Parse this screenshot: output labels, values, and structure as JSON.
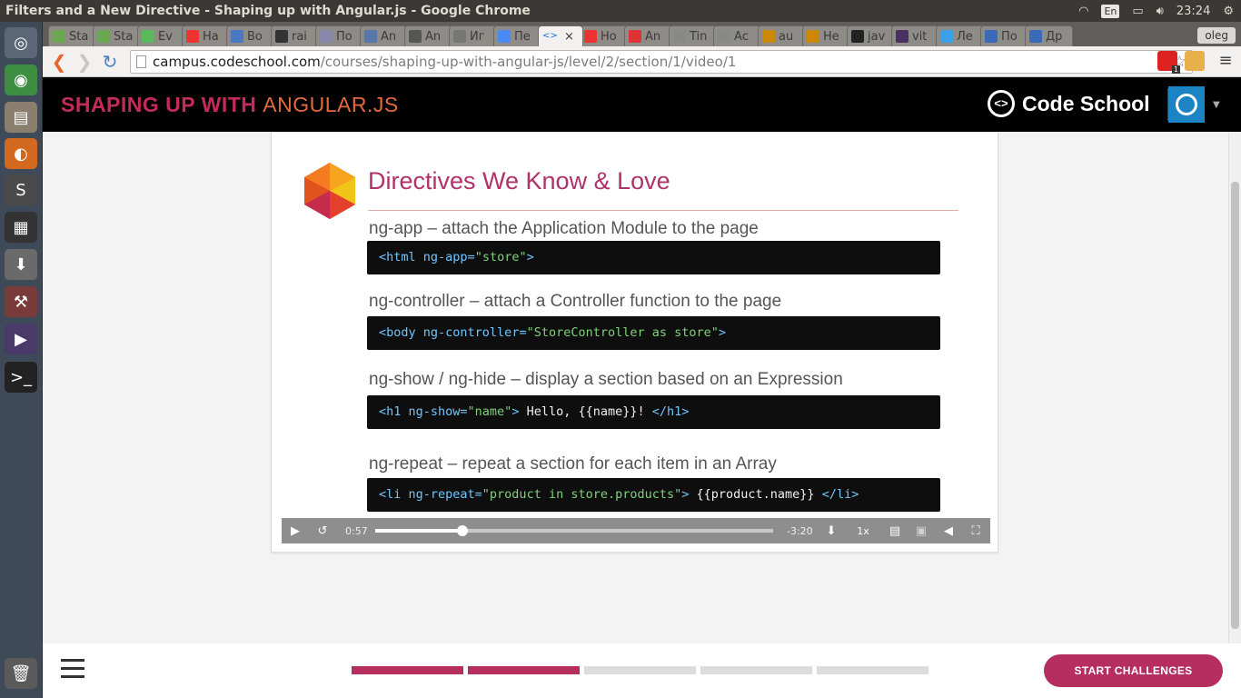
{
  "window": {
    "title": "Filters and a New Directive - Shaping up with Angular.js - Google Chrome",
    "keyboard_layout": "En",
    "clock": "23:24"
  },
  "launcher": {
    "apps": [
      "ubuntu-dash",
      "chrome",
      "files",
      "firefox",
      "sublime-text",
      "video-editor",
      "downloader",
      "system-settings",
      "media-player",
      "terminal"
    ],
    "trash": "trash"
  },
  "tabs": [
    {
      "label": "Sta",
      "color": "#6aa84f"
    },
    {
      "label": "Sta",
      "color": "#6aa84f"
    },
    {
      "label": "Ev",
      "color": "#5cb85c"
    },
    {
      "label": "На",
      "color": "#e33"
    },
    {
      "label": "Во",
      "color": "#4a78c2"
    },
    {
      "label": "rai",
      "color": "#333"
    },
    {
      "label": "По",
      "color": "#88a"
    },
    {
      "label": "An",
      "color": "#57a"
    },
    {
      "label": "An",
      "color": "#555"
    },
    {
      "label": "Иг",
      "color": "#777"
    },
    {
      "label": "Пе",
      "color": "#4a8af4"
    },
    {
      "label": "",
      "color": "#1a73e8",
      "active": true
    },
    {
      "label": "Но",
      "color": "#e33"
    },
    {
      "label": "An",
      "color": "#d33"
    },
    {
      "label": "Tin",
      "color": "#888"
    },
    {
      "label": "Ас",
      "color": "#888"
    },
    {
      "label": "au",
      "color": "#c80"
    },
    {
      "label": "Не",
      "color": "#c80"
    },
    {
      "label": "jav",
      "color": "#222"
    },
    {
      "label": "vit",
      "color": "#4a3060"
    },
    {
      "label": "Ле",
      "color": "#3aa0e8"
    },
    {
      "label": "По",
      "color": "#3a6ab8"
    },
    {
      "label": "Др",
      "color": "#3a6ab8"
    }
  ],
  "chrome_user": "oleg",
  "address": {
    "host": "campus.codeschool.com",
    "path": "/courses/shaping-up-with-angular-js/level/2/section/1/video/1"
  },
  "extensions": {
    "badge": "1"
  },
  "header": {
    "course_title_a": "SHAPING UP WITH",
    "course_title_b": "ANGULAR.JS",
    "brand": "Code School"
  },
  "slide": {
    "heading": "Directives We Know & Love",
    "directives": [
      {
        "label": "ng-app – attach the Application Module to the page",
        "code": [
          {
            "t": "<html ",
            "c": "t"
          },
          {
            "t": "ng-app=",
            "c": "t"
          },
          {
            "t": "\"store\"",
            "c": "s"
          },
          {
            "t": ">",
            "c": "t"
          }
        ]
      },
      {
        "label": "ng-controller – attach a Controller function to the page",
        "code": [
          {
            "t": "<body ",
            "c": "t"
          },
          {
            "t": "ng-controller=",
            "c": "t"
          },
          {
            "t": "\"StoreController as store\"",
            "c": "s"
          },
          {
            "t": ">",
            "c": "t"
          }
        ]
      },
      {
        "label": "ng-show / ng-hide – display a section based on an Expression",
        "code": [
          {
            "t": "<h1 ",
            "c": "t"
          },
          {
            "t": "ng-show=",
            "c": "t"
          },
          {
            "t": "\"name\"",
            "c": "s"
          },
          {
            "t": ">",
            "c": "t"
          },
          {
            "t": " Hello, {{name}}! ",
            "c": "p"
          },
          {
            "t": "</h1>",
            "c": "t"
          }
        ]
      },
      {
        "label": "ng-repeat – repeat a section for each item in an Array",
        "code": [
          {
            "t": "<li ",
            "c": "t"
          },
          {
            "t": "ng-repeat=",
            "c": "t"
          },
          {
            "t": "\"product in store.products\"",
            "c": "s"
          },
          {
            "t": ">",
            "c": "t"
          },
          {
            "t": " {{product.name}} ",
            "c": "p"
          },
          {
            "t": "</li>",
            "c": "t"
          }
        ]
      }
    ]
  },
  "player": {
    "elapsed": "0:57",
    "remaining": "-3:20",
    "progress_fraction": 0.22,
    "speed": "1x"
  },
  "bottom": {
    "progress_segments": [
      {
        "status": "done",
        "color": "#b52e5d"
      },
      {
        "status": "done",
        "color": "#b52e5d"
      },
      {
        "status": "todo",
        "color": "#dcdcdc"
      },
      {
        "status": "todo",
        "color": "#dcdcdc"
      },
      {
        "status": "todo",
        "color": "#dcdcdc"
      }
    ],
    "cta": "START CHALLENGES"
  }
}
